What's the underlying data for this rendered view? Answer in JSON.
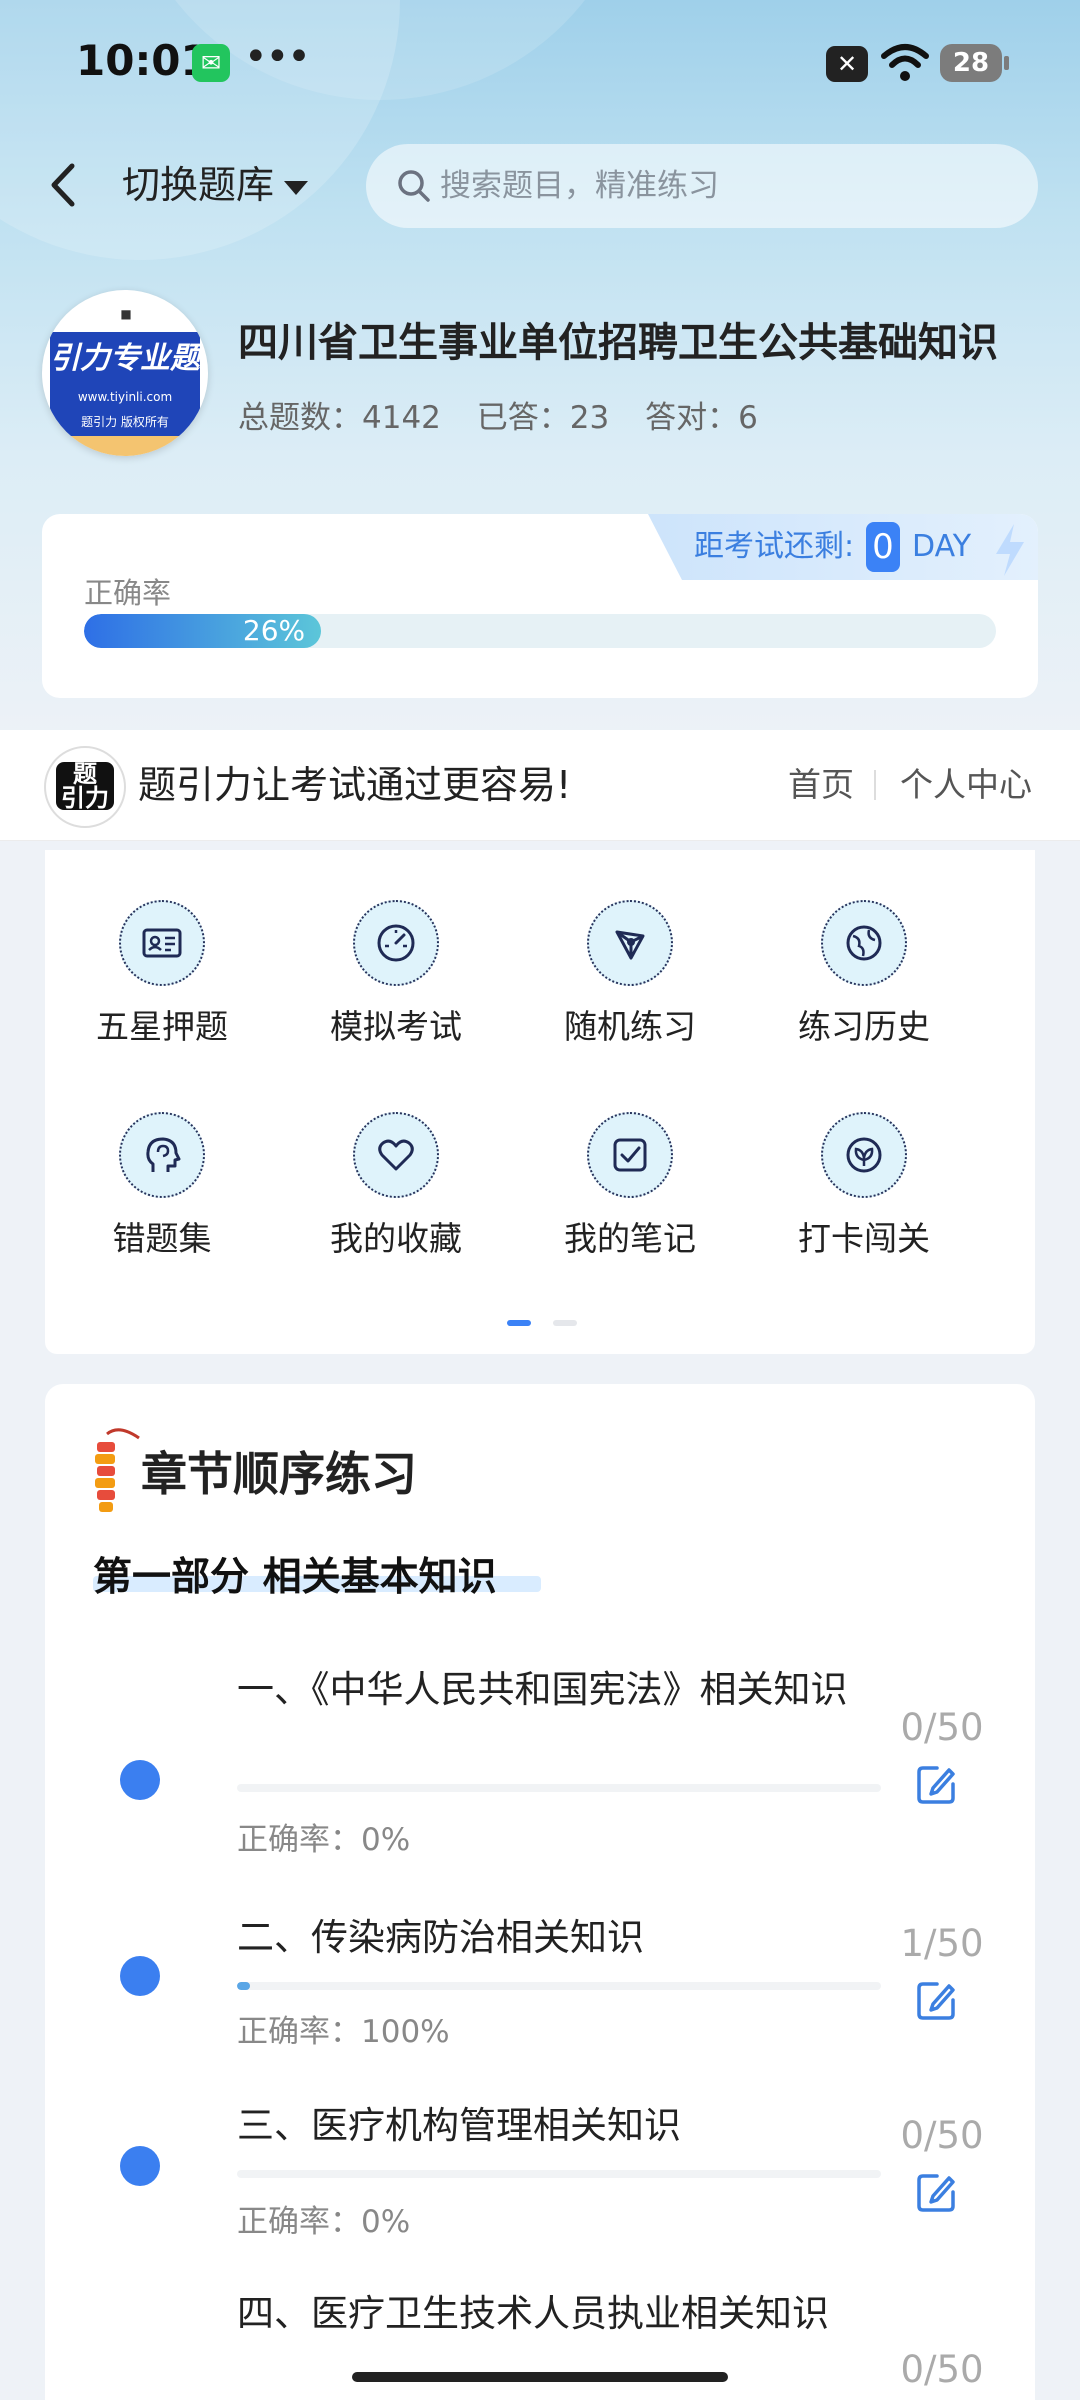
{
  "status": {
    "time": "10:01",
    "battery": "28"
  },
  "header": {
    "switch_label": "切换题库",
    "search_placeholder": "搜索题目，精准练习"
  },
  "bank": {
    "logo_text": "引力专业题",
    "logo_url": "www.tiyinli.com",
    "logo_footer": "题引力 版权所有",
    "title": "四川省卫生事业单位招聘卫生公共基础知识",
    "stats": [
      {
        "label": "总题数：",
        "value": "4142"
      },
      {
        "label": "已答：",
        "value": "23"
      },
      {
        "label": "答对：",
        "value": "6"
      }
    ]
  },
  "accuracy": {
    "label": "正确率",
    "percent_text": "26%",
    "percent": 0.26,
    "countdown_label": "距考试还剩:",
    "countdown_value": "0",
    "countdown_unit": "DAY"
  },
  "slogan": {
    "text": "题引力让考试通过更容易!",
    "nav_home": "首页",
    "nav_profile": "个人中心"
  },
  "features": [
    {
      "label": "五星押题",
      "icon": "id-card-icon"
    },
    {
      "label": "模拟考试",
      "icon": "speedometer-icon"
    },
    {
      "label": "随机练习",
      "icon": "network-icon"
    },
    {
      "label": "练习历史",
      "icon": "globe-icon"
    },
    {
      "label": "错题集",
      "icon": "head-icon"
    },
    {
      "label": "我的收藏",
      "icon": "heart-icon"
    },
    {
      "label": "我的笔记",
      "icon": "checkbox-icon"
    },
    {
      "label": "打卡闯关",
      "icon": "leaf-icon"
    }
  ],
  "chapters": {
    "title": "章节顺序练习",
    "part": "第一部分 相关基本知识",
    "items": [
      {
        "name": "一、《中华人民共和国宪法》相关知识",
        "rate": "正确率：0%",
        "count": "0/50",
        "progress": 0.0
      },
      {
        "name": "二、传染病防治相关知识",
        "rate": "正确率：100%",
        "count": "1/50",
        "progress": 0.02
      },
      {
        "name": "三、医疗机构管理相关知识",
        "rate": "正确率：0%",
        "count": "0/50",
        "progress": 0.0
      },
      {
        "name": "四、医疗卫生技术人员执业相关知识",
        "rate": "",
        "count": "0/50",
        "progress": 0.0
      }
    ]
  }
}
